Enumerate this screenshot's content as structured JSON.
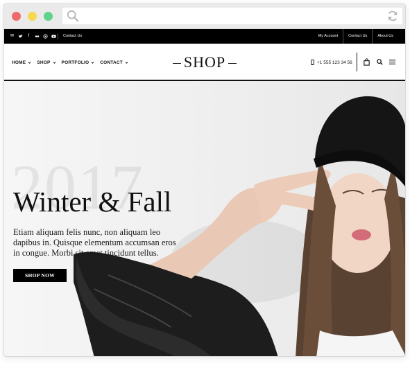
{
  "browser": {
    "traffic_lights": [
      "red",
      "yellow",
      "green"
    ],
    "colors": {
      "red": "#ef6a6a",
      "yellow": "#f5d84d",
      "green": "#5fd38b"
    },
    "url_icons": [
      "search-icon",
      "reload-icon"
    ]
  },
  "topbar": {
    "social_icons": [
      "mail-icon",
      "twitter-icon",
      "facebook-icon",
      "flickr-icon",
      "dribbble-icon",
      "youtube-icon"
    ],
    "left_link": "Contact Us",
    "right_links": [
      "My Account",
      "Contact Us",
      "About Us"
    ]
  },
  "header": {
    "nav": [
      "HOME",
      "SHOP",
      "PORTFOLIO",
      "CONTACT"
    ],
    "logo": "SHOP",
    "phone": "+1 555 123 34 56",
    "icons": [
      "shopping-bag-icon",
      "search-icon",
      "hamburger-menu-icon"
    ]
  },
  "hero": {
    "year": "2017",
    "title": "Winter & Fall",
    "text": "Etiam aliquam felis nunc, non aliquam leo dapibus in. Quisque elementum accumsan eros in congue. Morbi sit amet tincidunt tellus.",
    "button": "SHOP NOW"
  },
  "colors": {
    "accent": "#000000",
    "background": "#ffffff"
  }
}
